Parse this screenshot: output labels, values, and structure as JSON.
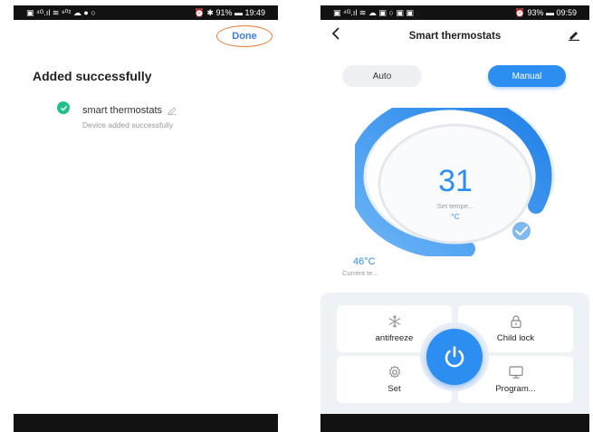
{
  "screen1": {
    "status": {
      "left": "▣ ⁴ᴳ.ıl ≋ ⁹⁰² ☁ ● ○",
      "right": "⏰ ✱ 91% ▬ 19:49"
    },
    "done_label": "Done",
    "title": "Added successfully",
    "device_name": "smart thermostats",
    "device_status": "Device added successfully"
  },
  "screen2": {
    "status": {
      "left": "▣ ⁴ᴳ.ıl ≋ ☁ ▣ ○ ▣ ▣",
      "right": "⏰ 93% ▬ 09:59"
    },
    "title": "Smart thermostats",
    "modes": {
      "auto": "Auto",
      "manual": "Manual"
    },
    "set_temp": "31",
    "set_label": "Set tempe...",
    "set_unit": "°C",
    "current_temp": "46°C",
    "current_label": "Current te...",
    "tiles": {
      "antifreeze": "antifreeze",
      "child_lock": "Child lock",
      "set": "Set",
      "program": "Program..."
    },
    "colors": {
      "accent": "#2c8ef0",
      "check": "#21c08b",
      "done_ring": "#e8792e"
    }
  }
}
